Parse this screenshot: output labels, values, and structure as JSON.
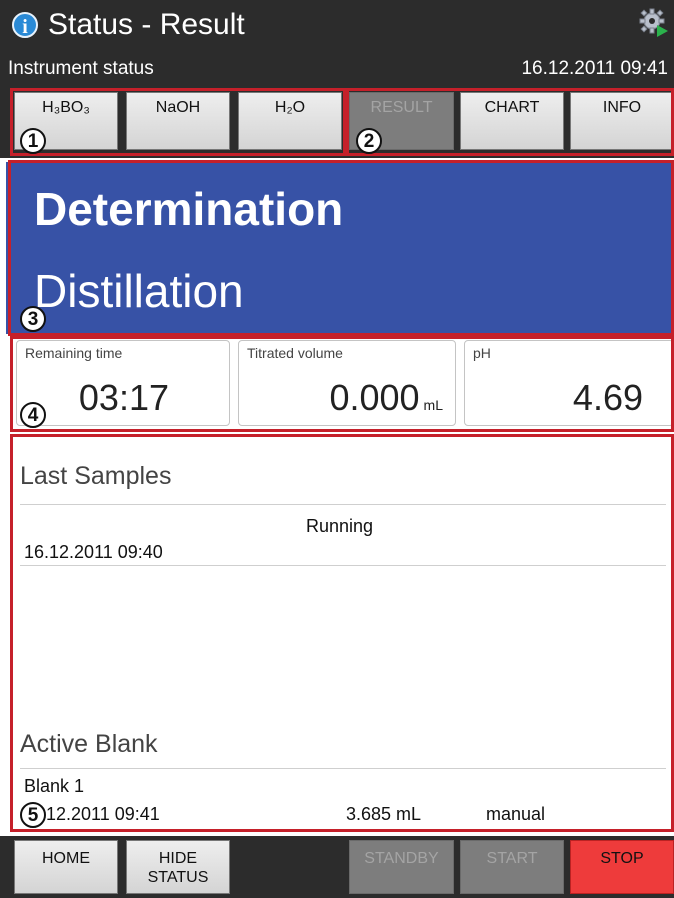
{
  "header": {
    "title": "Status - Result",
    "subtitle": "Instrument status",
    "datetime": "16.12.2011 09:41",
    "info_icon": "i"
  },
  "reagent_tabs": [
    "H₃BO₃",
    "NaOH",
    "H₂O"
  ],
  "view_tabs": [
    {
      "label": "RESULT",
      "state": "disabled"
    },
    {
      "label": "CHART",
      "state": "enabled"
    },
    {
      "label": "INFO",
      "state": "enabled"
    }
  ],
  "banner": {
    "line1": "Determination",
    "line2": "Distillation",
    "color": "#3752a6"
  },
  "values": {
    "remaining_time": {
      "label": "Remaining time",
      "value": "03:17"
    },
    "titrated_volume": {
      "label": "Titrated volume",
      "value": "0.000",
      "unit": "mL"
    },
    "ph": {
      "label": "pH",
      "value": "4.69"
    }
  },
  "last_samples": {
    "title": "Last Samples",
    "rows": [
      {
        "status": "Running",
        "datetime": "16.12.2011 09:40"
      }
    ]
  },
  "active_blank": {
    "title": "Active Blank",
    "name": "Blank 1",
    "datetime": "12.2011 09:41",
    "volume": "3.685 mL",
    "mode": "manual"
  },
  "callouts": [
    "1",
    "2",
    "3",
    "4",
    "5"
  ],
  "bottom_buttons": {
    "home": "HOME",
    "hide_status_line1": "HIDE",
    "hide_status_line2": "STATUS",
    "standby": "STANDBY",
    "start": "START",
    "stop": "STOP"
  },
  "colors": {
    "accent_red": "#c5202a",
    "stop": "#ee3b3b",
    "header_bg": "#2c2c2c"
  }
}
